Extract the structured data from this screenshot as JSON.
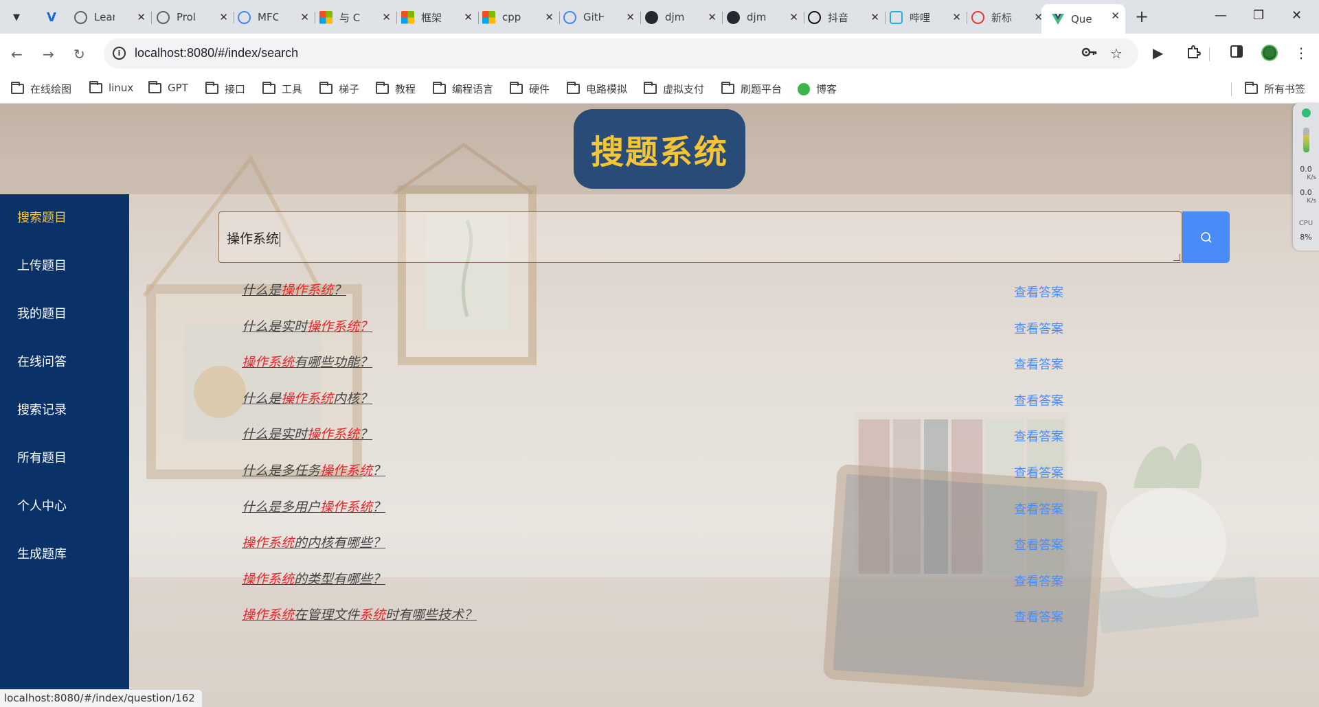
{
  "browser": {
    "tabs": [
      {
        "title": "Lear",
        "icon": "github-copilot-icon",
        "color": "#5f6368"
      },
      {
        "title": "Prol",
        "icon": "openai-icon",
        "color": "#5f6368"
      },
      {
        "title": "MFC",
        "icon": "google-icon",
        "color": "#4285f4"
      },
      {
        "title": "与 C",
        "icon": "microsoft-icon",
        "color": "#f25022"
      },
      {
        "title": "框架",
        "icon": "microsoft-icon",
        "color": "#f25022"
      },
      {
        "title": "cpp",
        "icon": "microsoft-icon",
        "color": "#f25022"
      },
      {
        "title": "GitH",
        "icon": "google-icon",
        "color": "#4285f4"
      },
      {
        "title": "djm",
        "icon": "github-icon",
        "color": "#24292f"
      },
      {
        "title": "djm",
        "icon": "github-icon",
        "color": "#24292f"
      },
      {
        "title": "抖音",
        "icon": "douyin-icon",
        "color": "#111111"
      },
      {
        "title": "哔哩",
        "icon": "bilibili-icon",
        "color": "#23ade5"
      },
      {
        "title": "新标",
        "icon": "infinity-icon",
        "color": "#e53935"
      },
      {
        "title": "Que",
        "icon": "vue-icon",
        "color": "#42b883"
      }
    ],
    "url": "localhost:8080/#/index/search",
    "bookmarks": [
      "在线绘图",
      "linux",
      "GPT",
      "接口",
      "工具",
      "梯子",
      "教程",
      "编程语言",
      "硬件",
      "电路模拟",
      "虚拟支付",
      "刷题平台",
      "博客"
    ],
    "all_bookmarks": "所有书签",
    "status_url": "localhost:8080/#/index/question/162"
  },
  "site": {
    "title": "搜题系统",
    "title_color": "#f4c534",
    "title_bg": "#284b77"
  },
  "sidebar": {
    "items": [
      {
        "label": "搜索题目",
        "active": true
      },
      {
        "label": "上传题目",
        "active": false
      },
      {
        "label": "我的题目",
        "active": false
      },
      {
        "label": "在线问答",
        "active": false
      },
      {
        "label": "搜索记录",
        "active": false
      },
      {
        "label": "所有题目",
        "active": false
      },
      {
        "label": "个人中心",
        "active": false
      },
      {
        "label": "生成题库",
        "active": false
      }
    ]
  },
  "search": {
    "value": "操作系统",
    "button_icon": "search-icon"
  },
  "results": {
    "highlight_color": "#e8262b",
    "action_label": "查看答案",
    "items": [
      {
        "parts": [
          {
            "t": "什么是",
            "h": false
          },
          {
            "t": "操作系统",
            "h": true
          },
          {
            "t": "？",
            "h": false
          }
        ]
      },
      {
        "parts": [
          {
            "t": "什么是实时",
            "h": false
          },
          {
            "t": "操作系统",
            "h": true
          },
          {
            "t": "？",
            "h": true
          }
        ]
      },
      {
        "parts": [
          {
            "t": "操作系统",
            "h": true
          },
          {
            "t": "有哪些功能？",
            "h": false
          }
        ]
      },
      {
        "parts": [
          {
            "t": "什么是",
            "h": false
          },
          {
            "t": "操作系统",
            "h": true
          },
          {
            "t": "内核？",
            "h": false
          }
        ]
      },
      {
        "parts": [
          {
            "t": "什么是实时",
            "h": false
          },
          {
            "t": "操作系统",
            "h": true
          },
          {
            "t": "？",
            "h": false
          }
        ]
      },
      {
        "parts": [
          {
            "t": "什么是多任务",
            "h": false
          },
          {
            "t": "操作系统",
            "h": true
          },
          {
            "t": "？",
            "h": false
          }
        ]
      },
      {
        "parts": [
          {
            "t": "什么是多用户",
            "h": false
          },
          {
            "t": "操作系统",
            "h": true
          },
          {
            "t": "？",
            "h": false
          }
        ]
      },
      {
        "parts": [
          {
            "t": "操作系统",
            "h": true
          },
          {
            "t": "的内核有哪些？",
            "h": false
          }
        ]
      },
      {
        "parts": [
          {
            "t": "操作系统",
            "h": true
          },
          {
            "t": "的类型有哪些？",
            "h": false
          }
        ]
      },
      {
        "parts": [
          {
            "t": "操作系统",
            "h": true
          },
          {
            "t": "在管理文件",
            "h": false
          },
          {
            "t": "系统",
            "h": true
          },
          {
            "t": "时有哪些技术？",
            "h": false
          }
        ]
      }
    ]
  },
  "widget": {
    "up_speed": "0.0",
    "up_unit": "K/s",
    "down_speed": "0.0",
    "down_unit": "K/s",
    "cpu_label": "CPU",
    "cpu_value": "8%"
  }
}
